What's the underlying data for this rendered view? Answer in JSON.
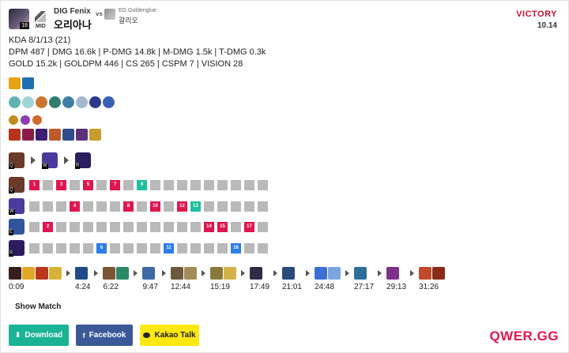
{
  "header": {
    "level": "18",
    "role": "MID",
    "player": "DIG Fenix",
    "champion": "오리아나",
    "vs": "vs",
    "opponent_player": "EG Goldenglue",
    "opponent_champion": "갈리오",
    "result": "VICTORY",
    "patch": "10.14",
    "result_color": "#c8102e"
  },
  "stats": {
    "line1": "KDA 8/1/13 (21)",
    "line2": "DPM 487 | DMG 16.6k | P-DMG 14.8k | M-DMG 1.5k | T-DMG 0.3k",
    "line3": "GOLD 15.2k | GOLDPM 446 | CS 265 | CSPM 7 | VISION 28"
  },
  "summoner_spells": [
    {
      "icon": "ignite-icon",
      "color": "#e8a213"
    },
    {
      "icon": "flash-icon",
      "color": "#1e6fb0"
    }
  ],
  "runes_primary": [
    {
      "icon": "rune-1-icon",
      "color": "#5fb3b3"
    },
    {
      "icon": "rune-2-icon",
      "color": "#9fd6d8"
    },
    {
      "icon": "rune-3-icon",
      "color": "#c9772f"
    },
    {
      "icon": "rune-4-icon",
      "color": "#2e7d6e"
    },
    {
      "icon": "rune-5-icon",
      "color": "#3f7fa6"
    },
    {
      "icon": "rune-6-icon",
      "color": "#a3b7cf"
    },
    {
      "icon": "rune-7-icon",
      "color": "#2d3a8c"
    },
    {
      "icon": "rune-8-icon",
      "color": "#3b5fb8"
    }
  ],
  "rune_shards": [
    {
      "icon": "shard-adaptive-icon",
      "color": "#c58b1e"
    },
    {
      "icon": "shard-adaptive-icon",
      "color": "#8a3fb0"
    },
    {
      "icon": "shard-armor-icon",
      "color": "#cf6a2b"
    }
  ],
  "final_items": [
    {
      "icon": "item-1-icon",
      "color": "#b8321c"
    },
    {
      "icon": "item-2-icon",
      "color": "#8c1d46"
    },
    {
      "icon": "item-3-icon",
      "color": "#3b1f73"
    },
    {
      "icon": "item-4-icon",
      "color": "#bf5a2a"
    },
    {
      "icon": "item-5-icon",
      "color": "#2e4d8a"
    },
    {
      "icon": "item-6-icon",
      "color": "#5e2f7d"
    },
    {
      "icon": "item-7-icon",
      "color": "#c99a2c"
    }
  ],
  "skill_max_order": [
    {
      "key": "Q",
      "icon": "skill-q-icon",
      "color": "#6a3a2a"
    },
    {
      "key": "W",
      "icon": "skill-w-icon",
      "color": "#4b3b9c"
    },
    {
      "key": "R",
      "icon": "skill-r-icon",
      "color": "#2c1e5e"
    }
  ],
  "skill_rows": [
    {
      "key": "Q",
      "icon": "skill-q-icon",
      "color": "#6a3a2a",
      "cells": [
        "1",
        "",
        "3",
        "",
        "5",
        "",
        "7",
        "",
        "9",
        "",
        "",
        "",
        "",
        "",
        "",
        "",
        "",
        ""
      ],
      "highlight": {
        "9": "green"
      }
    },
    {
      "key": "W",
      "icon": "skill-w-icon",
      "color": "#4b3b9c",
      "cells": [
        "",
        "",
        "",
        "4",
        "",
        "",
        "",
        "8",
        "",
        "10",
        "",
        "12",
        "13",
        "",
        "",
        "",
        "",
        ""
      ],
      "highlight": {
        "13": "green"
      }
    },
    {
      "key": "E",
      "icon": "skill-e-icon",
      "color": "#30559c",
      "cells": [
        "",
        "2",
        "",
        "",
        "",
        "",
        "",
        "",
        "",
        "",
        "",
        "",
        "",
        "14",
        "15",
        "",
        "17",
        ""
      ],
      "highlight": {}
    },
    {
      "key": "R",
      "icon": "skill-r-icon",
      "color": "#2c1e5e",
      "cells": [
        "",
        "",
        "",
        "",
        "",
        "6",
        "",
        "",
        "",
        "",
        "11",
        "",
        "",
        "",
        "",
        "16",
        "",
        ""
      ],
      "highlight": {}
    }
  ],
  "timeline": [
    {
      "time": "0:09",
      "items": [
        "#3a1e1e",
        "#e0a826",
        "#b8361c",
        "#d8b23a"
      ]
    },
    {
      "time": "4:24",
      "items": [
        "#1f4a8a"
      ]
    },
    {
      "time": "6:22",
      "items": [
        "#7a5533",
        "#2a8a66"
      ]
    },
    {
      "time": "9:47",
      "items": [
        "#3c6aa6"
      ]
    },
    {
      "time": "12:44",
      "items": [
        "#6b5a3c",
        "#a38c5a"
      ]
    },
    {
      "time": "15:19",
      "items": [
        "#8a7a3a",
        "#d4b24a"
      ]
    },
    {
      "time": "17:49",
      "items": [
        "#2e2e46"
      ]
    },
    {
      "time": "21:01",
      "items": [
        "#2a4a7a"
      ]
    },
    {
      "time": "24:48",
      "items": [
        "#3b6fd4",
        "#7aa5e0"
      ]
    },
    {
      "time": "27:17",
      "items": [
        "#2e6e9a"
      ]
    },
    {
      "time": "29:13",
      "items": [
        "#7e2f8c"
      ]
    },
    {
      "time": "31:26",
      "items": [
        "#c04a2a",
        "#8c2a1a"
      ]
    }
  ],
  "actions": {
    "show_match": "Show Match",
    "download": "Download",
    "facebook": "Facebook",
    "kakao": "Kakao Talk"
  },
  "brand": "QWER.GG"
}
